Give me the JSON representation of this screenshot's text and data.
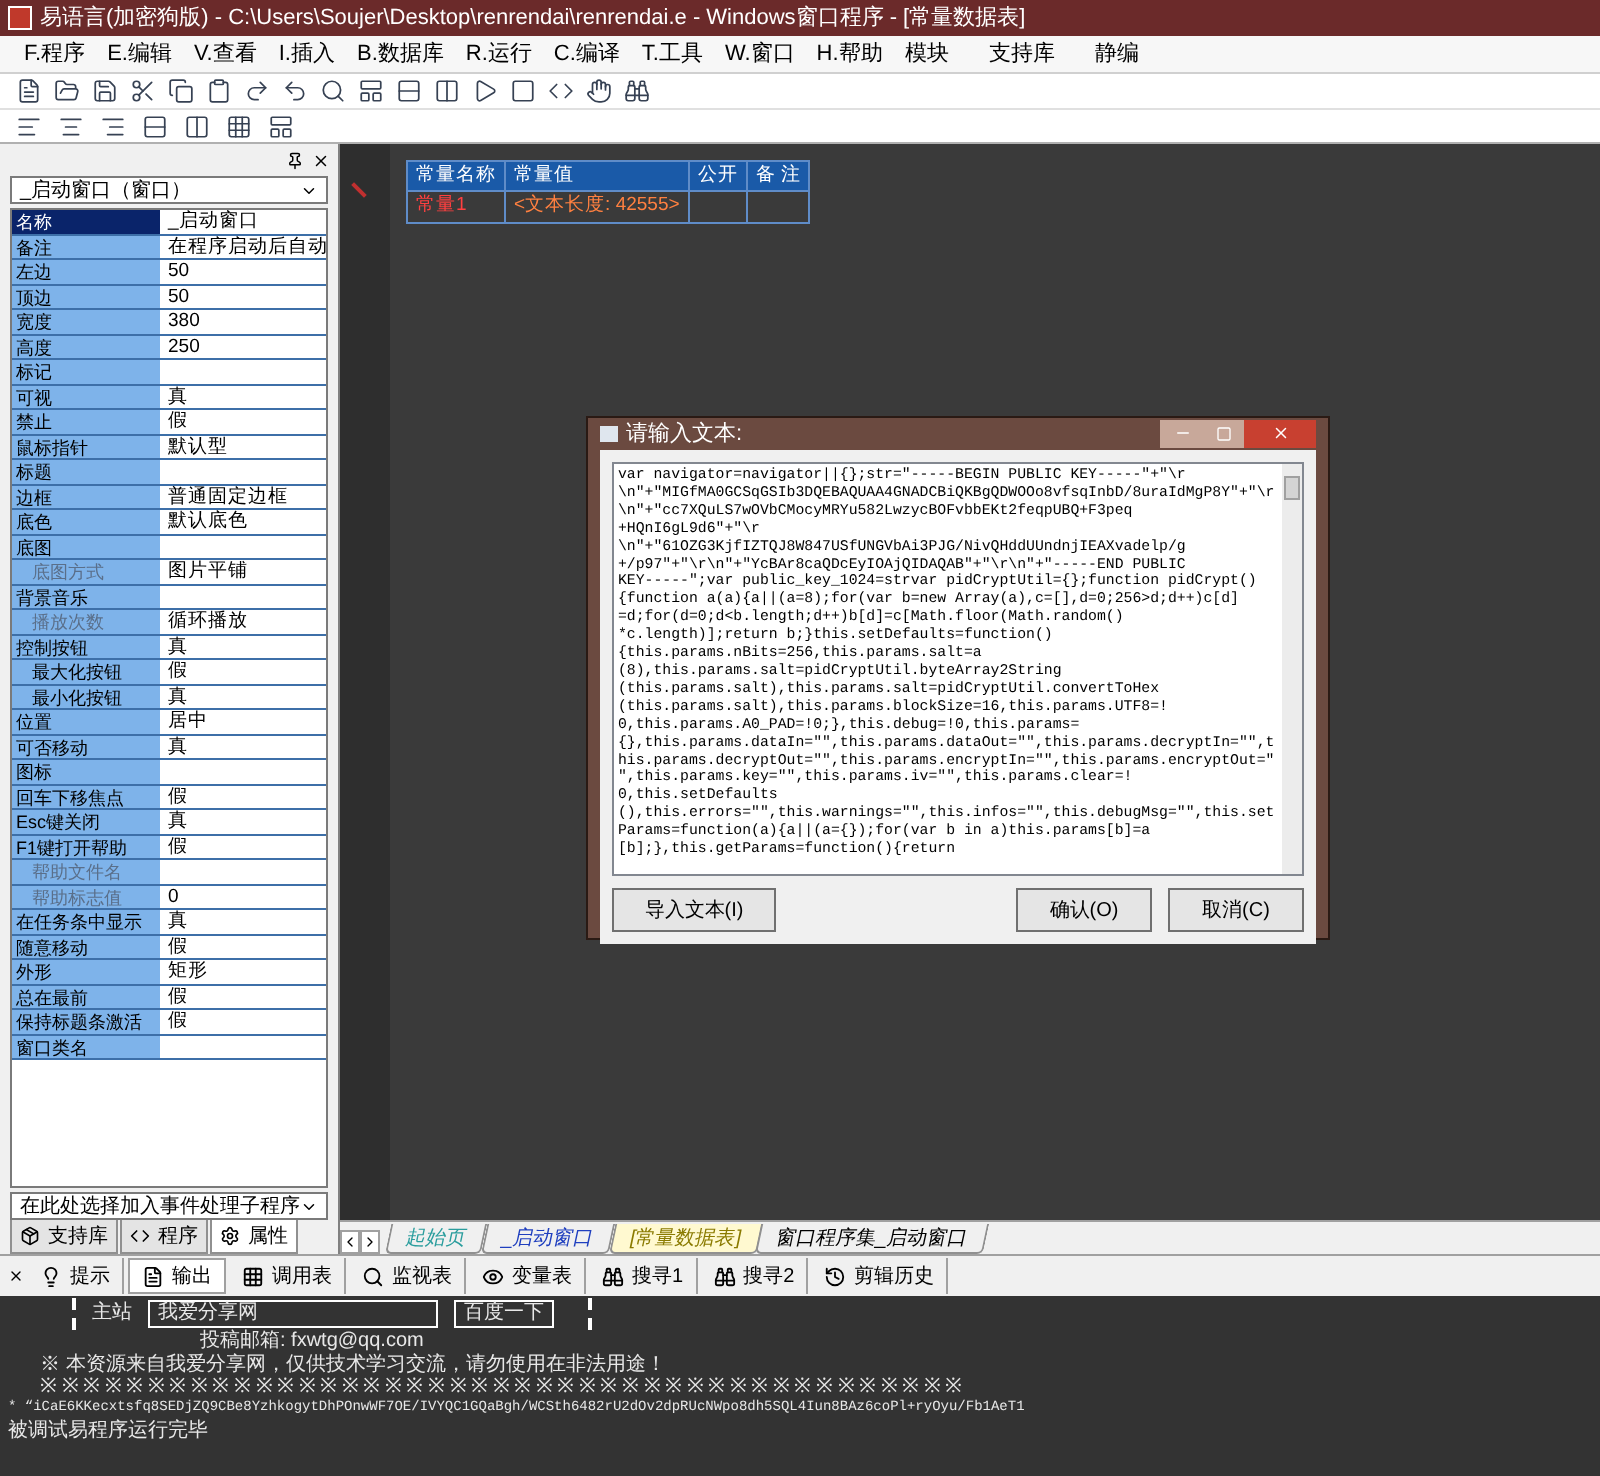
{
  "window": {
    "title": "易语言(加密狗版) - C:\\Users\\Soujer\\Desktop\\renrendai\\renrendai.e - Windows窗口程序 - [常量数据表]"
  },
  "menu": [
    "F.程序",
    "E.编辑",
    "V.查看",
    "I.插入",
    "B.数据库",
    "R.运行",
    "C.编译",
    "T.工具",
    "W.窗口",
    "H.帮助"
  ],
  "menu_right": [
    "模块",
    "支持库",
    "静编"
  ],
  "properties_panel": {
    "object_select": "_启动窗口（窗口）",
    "event_select": "在此处选择加入事件处理子程序",
    "rows": [
      {
        "name": "名称",
        "value": "_启动窗口",
        "selected": true,
        "indented": false,
        "disabled": false
      },
      {
        "name": "备注",
        "value": "在程序启动后自动",
        "selected": false,
        "indented": false,
        "disabled": false
      },
      {
        "name": "左边",
        "value": "50",
        "selected": false,
        "indented": false,
        "disabled": false
      },
      {
        "name": "顶边",
        "value": "50",
        "selected": false,
        "indented": false,
        "disabled": false
      },
      {
        "name": "宽度",
        "value": "380",
        "selected": false,
        "indented": false,
        "disabled": false
      },
      {
        "name": "高度",
        "value": "250",
        "selected": false,
        "indented": false,
        "disabled": false
      },
      {
        "name": "标记",
        "selected": false,
        "indented": false,
        "disabled": false
      },
      {
        "name": "可视",
        "value": "真",
        "selected": false,
        "indented": false,
        "disabled": false
      },
      {
        "name": "禁止",
        "value": "假",
        "selected": false,
        "indented": false,
        "disabled": false
      },
      {
        "name": "鼠标指针",
        "value": "默认型",
        "selected": false,
        "indented": false,
        "disabled": false
      },
      {
        "name": "标题",
        "selected": false,
        "indented": false,
        "disabled": false
      },
      {
        "name": "边框",
        "value": "普通固定边框",
        "selected": false,
        "indented": false,
        "disabled": false
      },
      {
        "name": "底色",
        "value": "默认底色",
        "selected": false,
        "indented": false,
        "disabled": false
      },
      {
        "name": "底图",
        "selected": false,
        "indented": false,
        "disabled": false
      },
      {
        "name": "底图方式",
        "value": "图片平铺",
        "selected": false,
        "indented": true,
        "disabled": true
      },
      {
        "name": "背景音乐",
        "selected": false,
        "indented": false,
        "disabled": false
      },
      {
        "name": "播放次数",
        "value": "循环播放",
        "selected": false,
        "indented": true,
        "disabled": true
      },
      {
        "name": "控制按钮",
        "value": "真",
        "selected": false,
        "indented": false,
        "disabled": false
      },
      {
        "name": "最大化按钮",
        "value": "假",
        "selected": false,
        "indented": true,
        "disabled": false
      },
      {
        "name": "最小化按钮",
        "value": "真",
        "selected": false,
        "indented": true,
        "disabled": false
      },
      {
        "name": "位置",
        "value": "居中",
        "selected": false,
        "indented": false,
        "disabled": false
      },
      {
        "name": "可否移动",
        "value": "真",
        "selected": false,
        "indented": false,
        "disabled": false
      },
      {
        "name": "图标",
        "selected": false,
        "indented": false,
        "disabled": false
      },
      {
        "name": "回车下移焦点",
        "value": "假",
        "selected": false,
        "indented": false,
        "disabled": false
      },
      {
        "name": "Esc键关闭",
        "value": "真",
        "selected": false,
        "indented": false,
        "disabled": false
      },
      {
        "name": "F1键打开帮助",
        "value": "假",
        "selected": false,
        "indented": false,
        "disabled": false
      },
      {
        "name": "帮助文件名",
        "selected": false,
        "indented": true,
        "disabled": true
      },
      {
        "name": "帮助标志值",
        "value": "0",
        "selected": false,
        "indented": true,
        "disabled": true
      },
      {
        "name": "在任务条中显示",
        "value": "真",
        "selected": false,
        "indented": false,
        "disabled": false
      },
      {
        "name": "随意移动",
        "value": "假",
        "selected": false,
        "indented": false,
        "disabled": false
      },
      {
        "name": "外形",
        "value": "矩形",
        "selected": false,
        "indented": false,
        "disabled": false
      },
      {
        "name": "总在最前",
        "value": "假",
        "selected": false,
        "indented": false,
        "disabled": false
      },
      {
        "name": "保持标题条激活",
        "value": "假",
        "selected": false,
        "indented": false,
        "disabled": false
      },
      {
        "name": "窗口类名",
        "selected": false,
        "indented": false,
        "disabled": false
      }
    ],
    "tabs": [
      {
        "label": "支持库",
        "selected": false
      },
      {
        "label": "程序",
        "selected": false
      },
      {
        "label": "属性",
        "selected": true
      }
    ]
  },
  "constants_table": {
    "columns": [
      "常量名称",
      "常量值",
      "公开",
      "备 注"
    ],
    "rows": [
      {
        "name": "常量1",
        "value": "<文本长度: 42555>"
      }
    ]
  },
  "dialog": {
    "title": "请输入文本:",
    "text": "var navigator=navigator||{};str=\"-----BEGIN PUBLIC KEY-----\"+\"\\r\n\\n\"+\"MIGfMA0GCSqGSIb3DQEBAQUAA4GNADCBiQKBgQDWOOo8vfsqInbD/8uraIdMgP8Y\"+\"\\r\n\\n\"+\"cc7XQuLS7wOVbCMocyMRYu582LwzycBOFvbbEKt2feqpUBQ+F3peq\n+HQnI6gL9d6\"+\"\\r\n\\n\"+\"61OZG3KjfIZTQJ8W847USfUNGVbAi3PJG/NivQHddUUndnjIEAXvadelp/g\n+/p97\"+\"\\r\\n\"+\"YcBAr8caQDcEyIOAjQIDAQAB\"+\"\\r\\n\"+\"-----END PUBLIC\nKEY-----\";var public_key_1024=strvar pidCryptUtil={};function pidCrypt()\n{function a(a){a||(a=8);for(var b=new Array(a),c=[],d=0;256>d;d++)c[d]\n=d;for(d=0;d<b.length;d++)b[d]=c[Math.floor(Math.random()\n*c.length)];return b;}this.setDefaults=function()\n{this.params.nBits=256,this.params.salt=a\n(8),this.params.salt=pidCryptUtil.byteArray2String\n(this.params.salt),this.params.salt=pidCryptUtil.convertToHex\n(this.params.salt),this.params.blockSize=16,this.params.UTF8=!\n0,this.params.A0_PAD=!0;},this.debug=!0,this.params=\n{},this.params.dataIn=\"\",this.params.dataOut=\"\",this.params.decryptIn=\"\",t\nhis.params.decryptOut=\"\",this.params.encryptIn=\"\",this.params.encryptOut=\"\n\",this.params.key=\"\",this.params.iv=\"\",this.params.clear=!\n0,this.setDefaults\n(),this.errors=\"\",this.warnings=\"\",this.infos=\"\",this.debugMsg=\"\",this.set\nParams=function(a){a||(a={});for(var b in a)this.params[b]=a\n[b];},this.getParams=function(){return",
    "buttons": [
      "导入文本(I)",
      "确认(O)",
      "取消(C)"
    ]
  },
  "editor_tabs": [
    {
      "label": "起始页",
      "selected": false,
      "color": "#2a9d9d"
    },
    {
      "label": "_启动窗口",
      "selected": false,
      "color": "#1f3fbf"
    },
    {
      "label": "[常量数据表]",
      "selected": true,
      "color": "#8a7a00"
    },
    {
      "label": "窗口程序集_启动窗口",
      "selected": false,
      "color": "#000000"
    }
  ],
  "output_tabs": [
    {
      "label": "提示",
      "selected": false
    },
    {
      "label": "输出",
      "selected": true
    },
    {
      "label": "调用表",
      "selected": false
    },
    {
      "label": "监视表",
      "selected": false
    },
    {
      "label": "变量表",
      "selected": false
    },
    {
      "label": "搜寻1",
      "selected": false
    },
    {
      "label": "搜寻2",
      "selected": false
    },
    {
      "label": "剪辑历史",
      "selected": false
    }
  ],
  "output": {
    "site_label": "主站",
    "site_field": "我爱分享网",
    "search_button": "百度一下",
    "email": "投稿邮箱: fxwtg@qq.com",
    "notice": "※ 本资源来自我爱分享网，仅供技术学习交流，请勿使用在非法用途！",
    "border": "※ ※ ※ ※ ※ ※ ※ ※ ※ ※ ※ ※ ※ ※ ※ ※ ※ ※ ※ ※ ※ ※ ※ ※ ※ ※ ※ ※ ※ ※ ※ ※ ※ ※ ※ ※ ※ ※ ※ ※ ※ ※ ※",
    "result": "* “iCaE6KKecxtsfq8SEDjZQ9CBe8YzhkogytDhPOnwWF7OE/IVYQC1GQaBgh/WCSth6482rU2dOv2dpRUcNWpo8dh5SQL4Iun8BAz6coPl+ryOyu/Fb1AeT1",
    "status": "被调试易程序运行完毕"
  }
}
